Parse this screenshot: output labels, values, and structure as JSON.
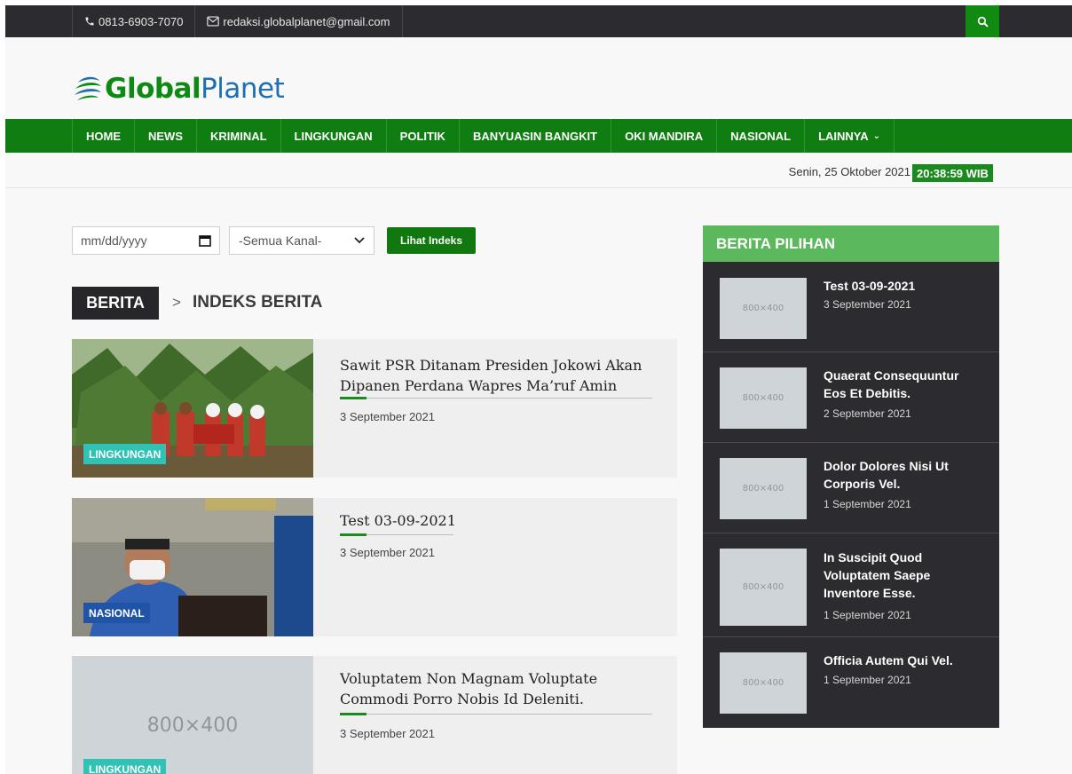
{
  "topbar": {
    "phone": "0813-6903-7070",
    "email": "redaksi.globalplanet@gmail.com",
    "search_icon": "search-icon"
  },
  "logo": {
    "part1": "Global",
    "part2": "Planet"
  },
  "nav": {
    "items": [
      {
        "label": "HOME"
      },
      {
        "label": "NEWS"
      },
      {
        "label": "KRIMINAL"
      },
      {
        "label": "LINGKUNGAN"
      },
      {
        "label": "POLITIK"
      },
      {
        "label": "BANYUASIN BANGKIT"
      },
      {
        "label": "OKI MANDIRA"
      },
      {
        "label": "NASIONAL"
      },
      {
        "label": "LAINNYA"
      }
    ]
  },
  "datebar": {
    "date": "Senin, 25 Oktober 2021",
    "time": "20:38:59 WIB"
  },
  "filters": {
    "date_placeholder": "mm/dd/yyyy",
    "channel_selected": "-Semua Kanal-",
    "button_label": "Lihat Indeks"
  },
  "breadcrumb": {
    "section": "BERITA",
    "separator": ">",
    "current": "INDEKS BERITA"
  },
  "articles": [
    {
      "title_line1": "Sawit PSR Ditanam Presiden Jokowi Akan",
      "title_line2": "Dipanen Perdana Wapres Ma’ruf Amin",
      "date": "3 September 2021",
      "category": "LINGKUNGAN"
    },
    {
      "title_line1": "Test 03-09-2021",
      "date": "3 September 2021",
      "category": "NASIONAL"
    },
    {
      "title_line1": "Voluptatem Non Magnam Voluptate",
      "title_line2": "Commodi Porro Nobis Id Deleniti.",
      "date": "3 September 2021",
      "category": "LINGKUNGAN",
      "placeholder": "800×400"
    }
  ],
  "sidebar": {
    "heading": "BERITA PILIHAN",
    "placeholder": "800×400",
    "items": [
      {
        "title": "Test 03-09-2021",
        "date": "3 September 2021"
      },
      {
        "title": "Quaerat Consequuntur Eos Et Debitis.",
        "date": "2 September 2021"
      },
      {
        "title": "Dolor Dolores Nisi Ut Corporis Vel.",
        "date": "1 September 2021"
      },
      {
        "title": "In Suscipit Quod Voluptatem Saepe Inventore Esse.",
        "date": "1 September 2021"
      },
      {
        "title": "Officia Autem Qui Vel.",
        "date": "1 September 2021"
      }
    ]
  },
  "colors": {
    "brand_green": "#0f7d12",
    "sidebar_head": "#5cb85c",
    "dark": "#2b2b30",
    "badge_teal": "#30c2b4",
    "badge_blue": "#1f54a6"
  }
}
